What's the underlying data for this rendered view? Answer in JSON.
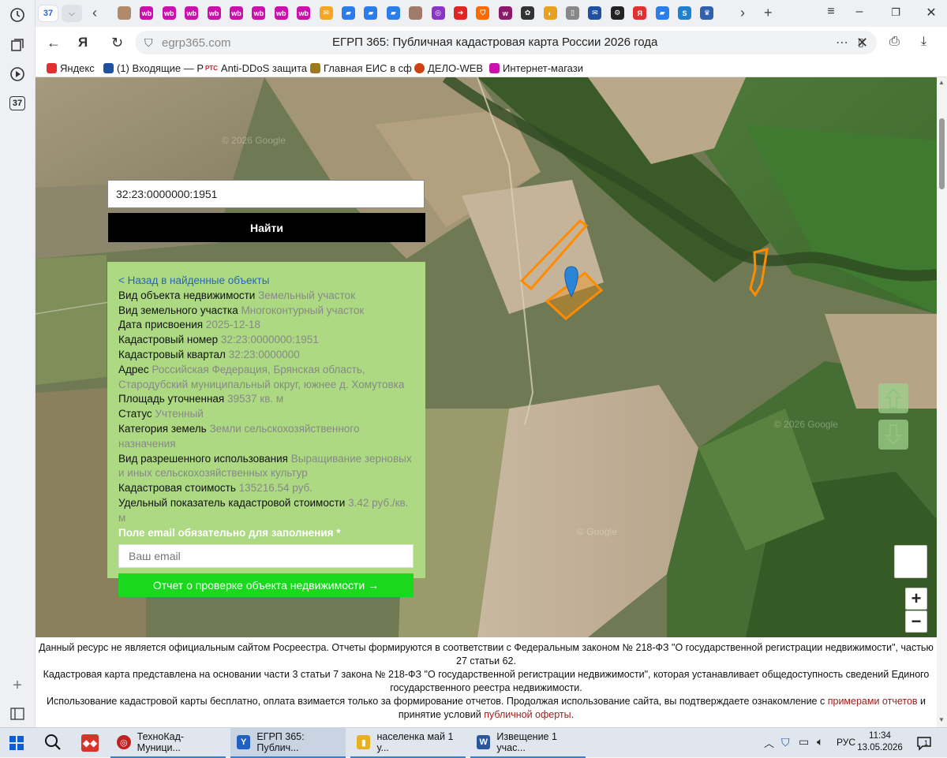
{
  "browser": {
    "tabs_count": "37",
    "tab_favicons": [
      {
        "icon": "avatar-icon",
        "color": "#b08a6a",
        "label": ""
      },
      {
        "icon": "wb-icon",
        "color": "#cb11ab",
        "label": "wb"
      },
      {
        "icon": "wb-icon",
        "color": "#cb11ab",
        "label": "wb"
      },
      {
        "icon": "wb-icon",
        "color": "#cb11ab",
        "label": "wb"
      },
      {
        "icon": "wb-icon",
        "color": "#cb11ab",
        "label": "wb"
      },
      {
        "icon": "wb-icon",
        "color": "#cb11ab",
        "label": "wb"
      },
      {
        "icon": "wb-icon",
        "color": "#cb11ab",
        "label": "wb"
      },
      {
        "icon": "wb-icon",
        "color": "#cb11ab",
        "label": "wb"
      },
      {
        "icon": "wb-icon",
        "color": "#cb11ab",
        "label": "wb"
      },
      {
        "icon": "mail-icon",
        "color": "#f5a623",
        "label": "✉"
      },
      {
        "icon": "doc-icon",
        "color": "#2b7de9",
        "label": "▰"
      },
      {
        "icon": "doc-icon",
        "color": "#2b7de9",
        "label": "▰"
      },
      {
        "icon": "doc-icon",
        "color": "#2b7de9",
        "label": "▰"
      },
      {
        "icon": "avatar-icon",
        "color": "#a07a6a",
        "label": ""
      },
      {
        "icon": "ring-icon",
        "color": "#8b35c8",
        "label": "◎"
      },
      {
        "icon": "arrow-icon",
        "color": "#e02424",
        "label": "➔"
      },
      {
        "icon": "shield-icon",
        "color": "#ff6a00",
        "label": "⛉"
      },
      {
        "icon": "w-icon",
        "color": "#8a1a6a",
        "label": "w"
      },
      {
        "icon": "paw-icon",
        "color": "#333333",
        "label": "✿"
      },
      {
        "icon": "pill-icon",
        "color": "#e8a020",
        "label": "◐"
      },
      {
        "icon": "page-icon",
        "color": "#888888",
        "label": "▯"
      },
      {
        "icon": "mail-icon",
        "color": "#2050a0",
        "label": "✉"
      },
      {
        "icon": "gear-icon",
        "color": "#222222",
        "label": "⚙"
      },
      {
        "icon": "yandex-icon",
        "color": "#e03030",
        "label": "Я"
      },
      {
        "icon": "doc-icon",
        "color": "#2b7de9",
        "label": "▰"
      },
      {
        "icon": "s-icon",
        "color": "#2080d0",
        "label": "S"
      },
      {
        "icon": "emblem-icon",
        "color": "#3060b0",
        "label": "♛"
      }
    ],
    "url": "egrp365.com",
    "page_title": "ЕГРП 365: Публичная кадастровая карта России 2026 года",
    "bookmarks": [
      {
        "label": "Яндекс",
        "color": "#e03030"
      },
      {
        "label": "(1) Входящие — Р",
        "color": "#2050a0"
      },
      {
        "label": "Anti-DDoS защита",
        "color": "#d02020"
      },
      {
        "label": "Главная ЕИС в сф",
        "color": "#a07820"
      },
      {
        "label": "ДЕЛО-WEB",
        "color": "#d04010"
      },
      {
        "label": "Интернет-магази",
        "color": "#cb11ab"
      }
    ],
    "bookmark_prefix_rtc": "РТС"
  },
  "search": {
    "value": "32:23:0000000:1951",
    "button_label": "Найти"
  },
  "info": {
    "back_link": "< Назад в найденные объекты",
    "rows": [
      {
        "label": "Вид объекта недвижимости",
        "value": "Земельный участок"
      },
      {
        "label": "Вид земельного участка",
        "value": "Многоконтурный участок"
      },
      {
        "label": "Дата присвоения",
        "value": "2025-12-18"
      },
      {
        "label": "Кадастровый номер",
        "value": "32:23:0000000:1951"
      },
      {
        "label": "Кадастровый квартал",
        "value": "32:23:0000000"
      },
      {
        "label": "Адрес",
        "value": "Российская Федерация, Брянская область, Стародубский муниципальный округ, южнее д. Хомутовка"
      },
      {
        "label": "Площадь уточненная",
        "value": "39537 кв. м"
      },
      {
        "label": "Статус",
        "value": "Учтенный"
      },
      {
        "label": "Категория земель",
        "value": "Земли сельскохозяйственного назначения"
      },
      {
        "label": "Вид разрешенного использования",
        "value": "Выращивание зерновых и иных сельскохозяйственных культур"
      },
      {
        "label": "Кадастровая стоимость",
        "value": "135216.54 руб."
      },
      {
        "label": "Удельный показатель кадастровой стоимости",
        "value": "3.42 руб./кв. м"
      }
    ],
    "email_label": "Поле email обязательно для заполнения *",
    "email_placeholder": "Ваш email",
    "report_button": "Отчет о проверке объекта недвижимости →"
  },
  "map": {
    "watermarks": [
      "© 2026 Google",
      "© 2026 Google",
      "© Google"
    ],
    "zoom_in": "+",
    "zoom_out": "−",
    "parcel_color": "#ff8c00"
  },
  "footer": {
    "line1": "Данный ресурс не является официальным сайтом Росреестра. Отчеты формируются в соответствии с Федеральным законом № 218-ФЗ \"О государственной регистрации недвижимости\", частью 27 статьи 62.",
    "line2": "Кадастровая карта представлена на основании части 3 статьи 7 закона № 218-ФЗ \"О государственной регистрации недвижимости\", которая устанавливает общедоступность сведений Единого государственного реестра недвижимости.",
    "line3_a": "Использование кадастровой карты бесплатно, оплата взимается только за формирование отчетов. Продолжая использование сайта, вы подтверждаете ознакомление с ",
    "line3_link1": "примерами отчетов",
    "line3_b": " и принятие условий ",
    "line3_link2": "публичной оферты",
    "line3_c": "."
  },
  "taskbar": {
    "apps": [
      {
        "label": "ТехноКад-Муници...",
        "color": "#c02020"
      },
      {
        "label": "ЕГРП 365: Публич...",
        "color": "#2060c0"
      },
      {
        "label": "населенка май 1 у...",
        "color": "#e8b020"
      },
      {
        "label": "Извещение 1 учас...",
        "color": "#2b579a"
      }
    ],
    "language": "РУС",
    "time": "11:34",
    "date": "13.05.2026",
    "notifications": "1"
  }
}
